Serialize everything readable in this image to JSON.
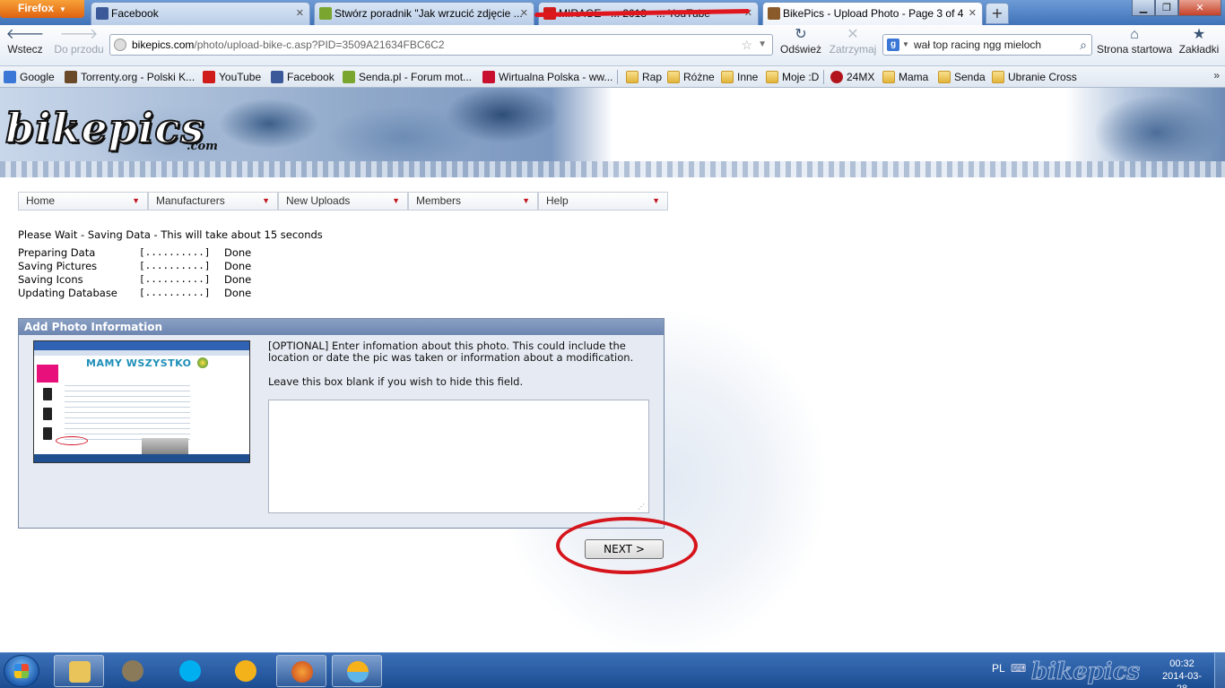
{
  "browser": {
    "menu_button": "Firefox",
    "tabs": [
      {
        "title": "Facebook",
        "icon_color": "#3b5998"
      },
      {
        "title": "Stwórz poradnik \"Jak wrzucić zdjęcie ...",
        "icon_color": "#7aa630"
      },
      {
        "title": "MIRAGE - ... 2013 - ...  YouTube",
        "icon_color": "#d01b1b"
      },
      {
        "title": "BikePics - Upload Photo - Page 3 of 4",
        "icon_color": "#8a5a2a"
      }
    ],
    "new_tab": "+",
    "nav": {
      "back": "Wstecz",
      "forward": "Do przodu",
      "reload": "Odśwież",
      "stop": "Zatrzymaj",
      "home": "Strona startowa",
      "bookmarks": "Zakładki"
    },
    "url_domain": "bikepics.com",
    "url_path": "/photo/upload-bike-c.asp?PID=3509A21634FBC6C2",
    "search_value": "wał top racing ngg mieloch",
    "bookmarks": [
      {
        "label": "Google",
        "type": "site",
        "color": "#3b77d6"
      },
      {
        "label": "Torrenty.org - Polski K...",
        "type": "site",
        "color": "#6b4a2a"
      },
      {
        "label": "YouTube",
        "type": "site",
        "color": "#d01b1b"
      },
      {
        "label": "Facebook",
        "type": "site",
        "color": "#3b5998"
      },
      {
        "label": "Senda.pl - Forum mot...",
        "type": "site",
        "color": "#7aa630"
      },
      {
        "label": "Wirtualna Polska - ww...",
        "type": "site",
        "color": "#c8102e"
      },
      {
        "label": "Rap",
        "type": "folder"
      },
      {
        "label": "Różne",
        "type": "folder"
      },
      {
        "label": "Inne",
        "type": "folder"
      },
      {
        "label": "Moje :D",
        "type": "folder"
      },
      {
        "label": "24MX",
        "type": "site",
        "color": "#b3141c"
      },
      {
        "label": "Mama",
        "type": "folder"
      },
      {
        "label": "Senda",
        "type": "folder"
      },
      {
        "label": "Ubranie Cross",
        "type": "folder"
      }
    ],
    "bookmarks_more": "»"
  },
  "site": {
    "logo": "bikepics",
    "logo_sub": ".com",
    "menu": [
      "Home",
      "Manufacturers",
      "New Uploads",
      "Members",
      "Help"
    ],
    "status_heading": "Please Wait - Saving Data - This will take about 15 seconds",
    "status_rows": [
      {
        "label": "Preparing Data",
        "bar": "[..........]",
        "state": "Done"
      },
      {
        "label": "Saving Pictures",
        "bar": "[..........]",
        "state": "Done"
      },
      {
        "label": "Saving Icons",
        "bar": "[..........]",
        "state": "Done"
      },
      {
        "label": "Updating Database",
        "bar": "[..........]",
        "state": "Done"
      }
    ],
    "panel": {
      "title": "Add Photo Information",
      "thumbnail_heading": "MAMY WSZYSTKO",
      "description": "[OPTIONAL] Enter infomation about this photo. This could include the location or date the pic was taken or information about a modification.",
      "hint": "Leave this box blank if you wish to hide this field.",
      "textarea_value": ""
    },
    "next_button": "NEXT >"
  },
  "taskbar": {
    "apps": [
      {
        "name": "explorer",
        "color": "#e8c45a",
        "pinned": true
      },
      {
        "name": "gimp",
        "color": "#8a7a5a",
        "pinned": false
      },
      {
        "name": "skype",
        "color": "#00aff0",
        "pinned": false
      },
      {
        "name": "weather",
        "color": "#f3b21a",
        "pinned": false
      },
      {
        "name": "firefox",
        "color": "#e8661a",
        "pinned": true
      },
      {
        "name": "weather-widget",
        "color": "#f7b21a",
        "pinned": true
      }
    ],
    "language": "PL",
    "time": "00:32",
    "date": "2014-03-28"
  },
  "colors": {
    "annotation_red": "#d6141c",
    "menu_caret": "#c0161e",
    "panel_header": "#7a91b8"
  }
}
